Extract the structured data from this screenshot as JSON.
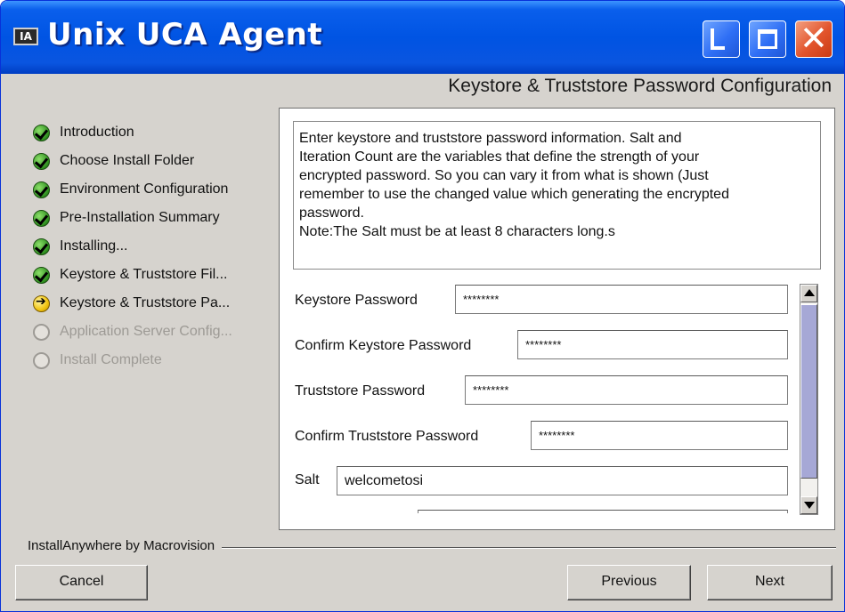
{
  "window": {
    "icon_text": "IA",
    "title": "Unix UCA  Agent"
  },
  "step_header": "Keystore & Truststore Password Configuration",
  "steps": [
    {
      "label": "Introduction",
      "status": "done"
    },
    {
      "label": "Choose Install Folder",
      "status": "done"
    },
    {
      "label": "Environment Configuration",
      "status": "done"
    },
    {
      "label": "Pre-Installation Summary",
      "status": "done"
    },
    {
      "label": "Installing...",
      "status": "done"
    },
    {
      "label": "Keystore & Truststore Fil...",
      "status": "done"
    },
    {
      "label": "Keystore & Truststore Pa...",
      "status": "current"
    },
    {
      "label": "Application Server  Config...",
      "status": "pending"
    },
    {
      "label": "Install Complete",
      "status": "pending"
    }
  ],
  "description": {
    "lines": [
      "Enter keystore and truststore password information. Salt and",
      "Iteration Count are the variables that define the strength of your",
      "encrypted password. So you can vary it from what is shown (Just",
      "remember to use the changed value which generating the encrypted",
      "password.",
      "Note:The Salt must be at least 8 characters long.s"
    ]
  },
  "form": {
    "keystore_password": {
      "label": "Keystore Password",
      "value": "********"
    },
    "confirm_keystore_password": {
      "label": "Confirm Keystore Password",
      "value": "********"
    },
    "truststore_password": {
      "label": "Truststore Password",
      "value": "********"
    },
    "confirm_truststore_password": {
      "label": "Confirm Truststore Password",
      "value": "********"
    },
    "salt": {
      "label": "Salt",
      "value": "welcometosi"
    }
  },
  "footer": {
    "vendor": "InstallAnywhere by Macrovision",
    "cancel_label": "Cancel",
    "previous_label": "Previous",
    "next_label": "Next"
  }
}
